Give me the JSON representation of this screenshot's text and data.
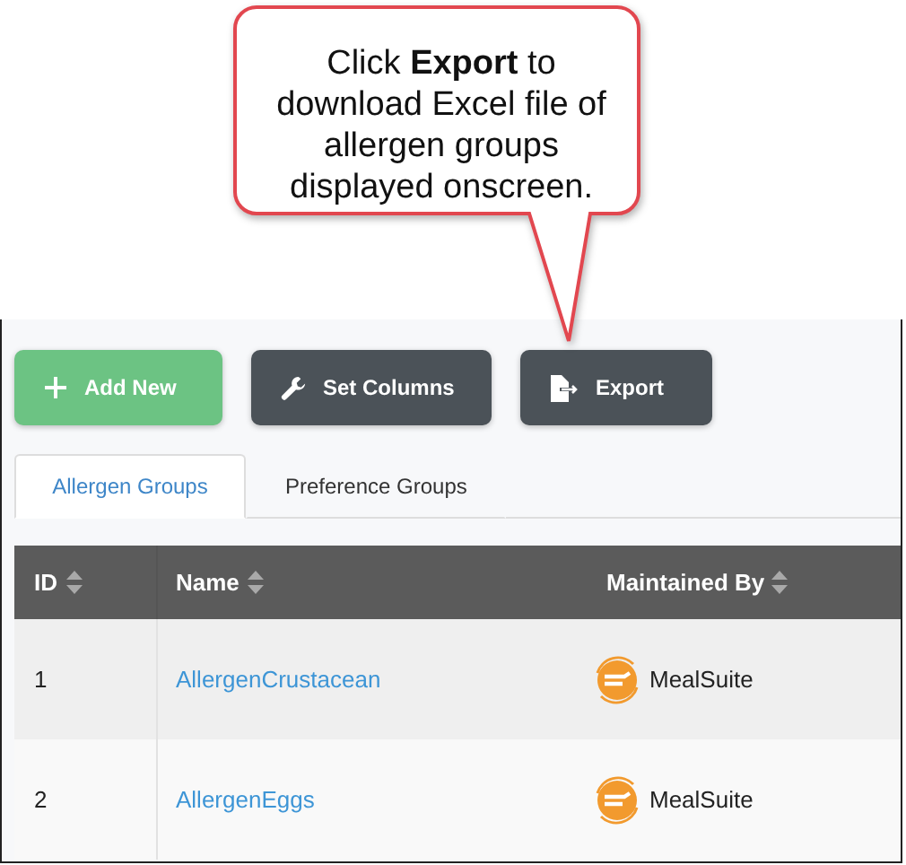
{
  "callout": {
    "text": "Click **Export** to download Excel file of allergen groups displayed onscreen."
  },
  "toolbar": [
    {
      "label": "Add New",
      "kind": "add"
    },
    {
      "label": "Set Columns",
      "kind": "columns"
    },
    {
      "label": "Export",
      "kind": "export"
    }
  ],
  "tabs": [
    {
      "label": "Allergen Groups",
      "selected": true
    },
    {
      "label": "Preference Groups",
      "selected": false
    }
  ],
  "table": {
    "columns": [
      "ID",
      "Name",
      "Maintained By"
    ],
    "rows": [
      {
        "id": "1",
        "name": "AllergenCrustacean",
        "maintained_by": "MealSuite"
      },
      {
        "id": "2",
        "name": "AllergenEggs",
        "maintained_by": "MealSuite"
      }
    ]
  }
}
